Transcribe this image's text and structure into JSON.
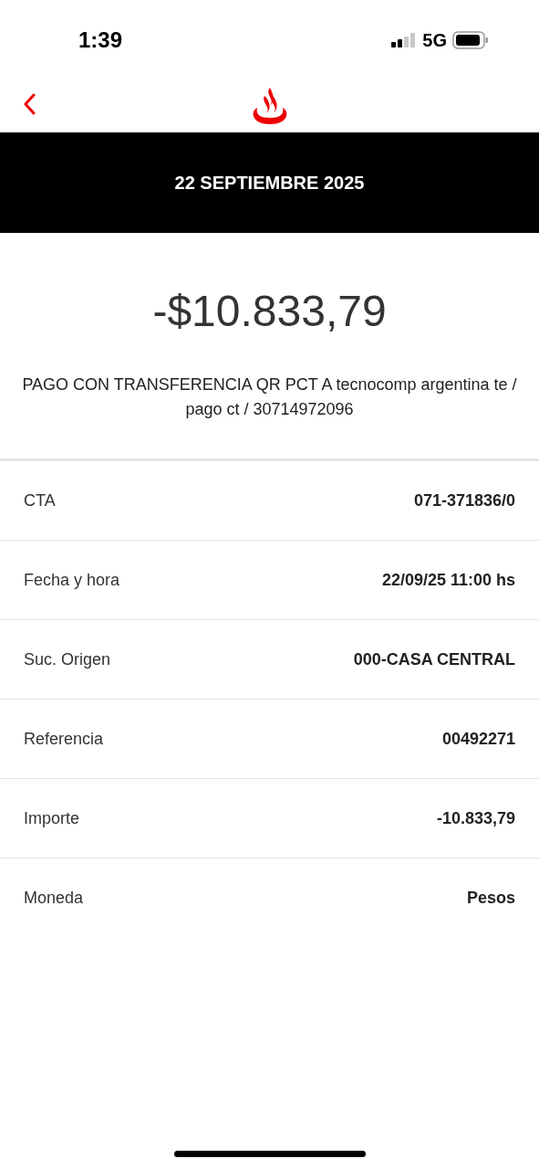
{
  "status_bar": {
    "time": "1:39",
    "network": "5G"
  },
  "header": {
    "date": "22 SEPTIEMBRE 2025"
  },
  "amount": "-$10.833,79",
  "description": "PAGO CON TRANSFERENCIA QR PCT A tecnocomp argentina te / pago ct / 30714972096",
  "details": [
    {
      "label": "CTA",
      "value": "071-371836/0"
    },
    {
      "label": "Fecha y hora",
      "value": "22/09/25 11:00 hs"
    },
    {
      "label": "Suc. Origen",
      "value": "000-CASA CENTRAL"
    },
    {
      "label": "Referencia",
      "value": "00492271"
    },
    {
      "label": "Importe",
      "value": "-10.833,79"
    },
    {
      "label": "Moneda",
      "value": "Pesos"
    }
  ]
}
